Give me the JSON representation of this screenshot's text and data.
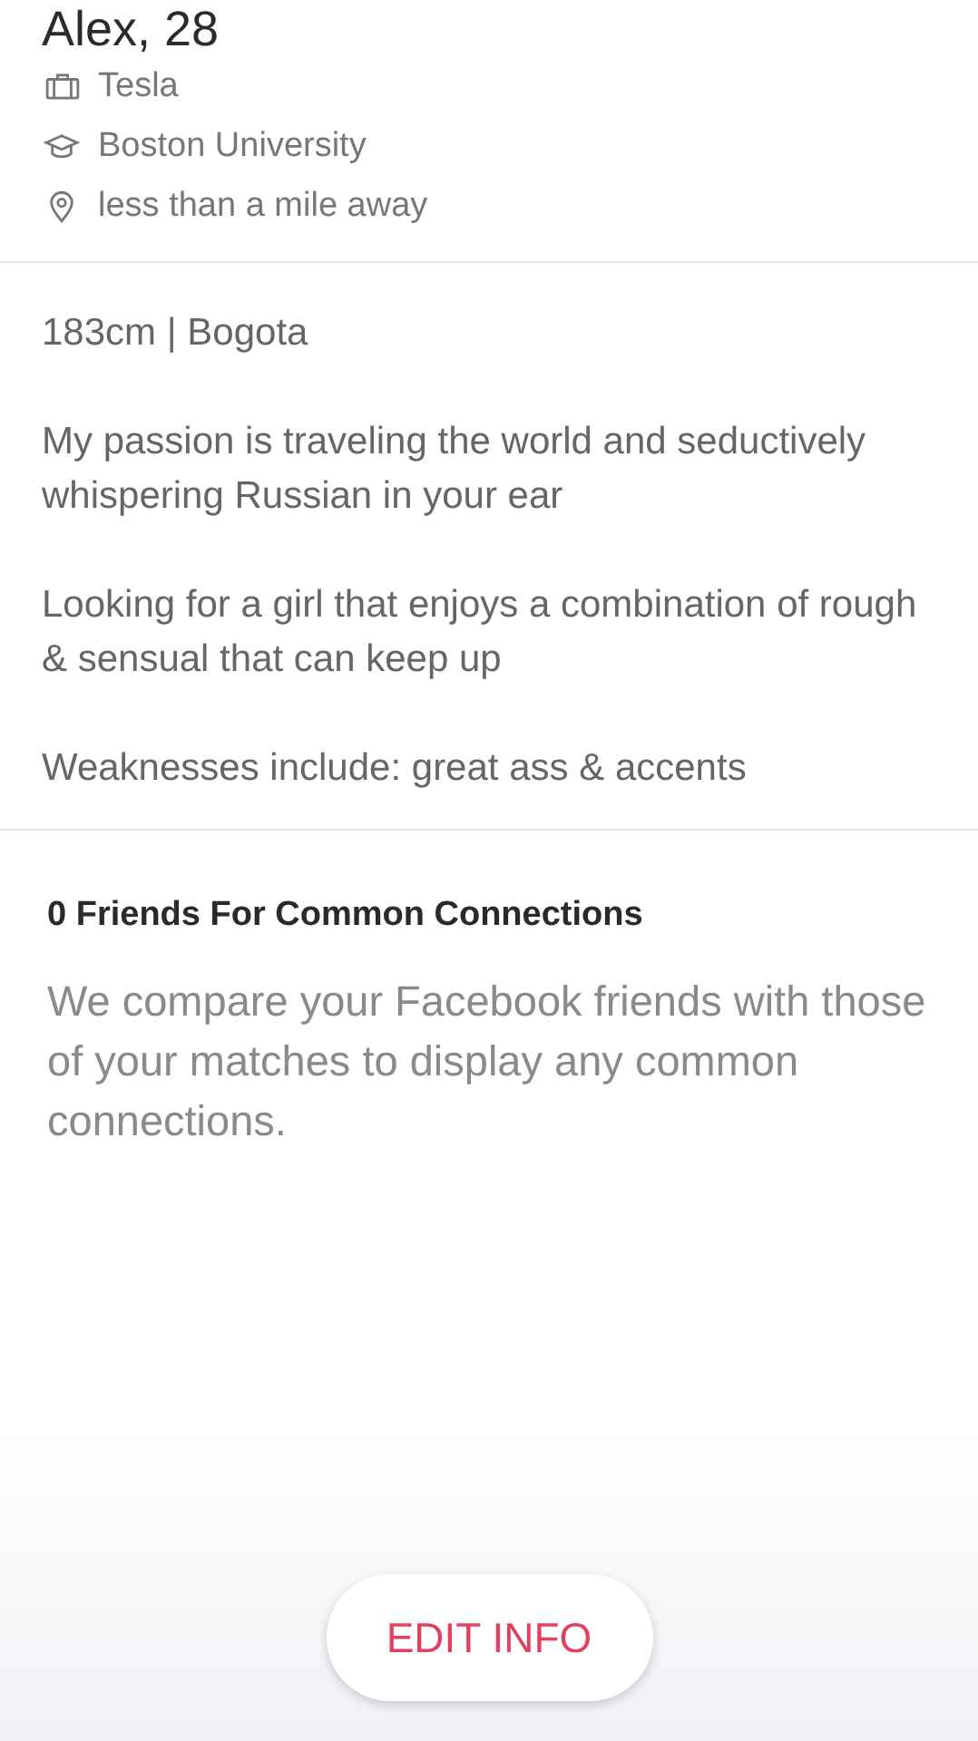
{
  "profile": {
    "name_age": "Alex, 28",
    "details": [
      {
        "kind": "job",
        "text": "Tesla"
      },
      {
        "kind": "school",
        "text": "Boston University"
      },
      {
        "kind": "distance",
        "text": "less than a mile away"
      }
    ]
  },
  "bio": [
    "183cm | Bogota",
    "My passion is traveling the world and seductively whispering Russian in your ear",
    "Looking for a girl that enjoys a combination of rough & sensual that can keep up",
    "Weaknesses include: great ass & accents"
  ],
  "connections": {
    "heading": "0 Friends For Common Connections",
    "description": "We compare your Facebook friends with those of your matches to display any common connections."
  },
  "button": {
    "label": "EDIT INFO"
  }
}
